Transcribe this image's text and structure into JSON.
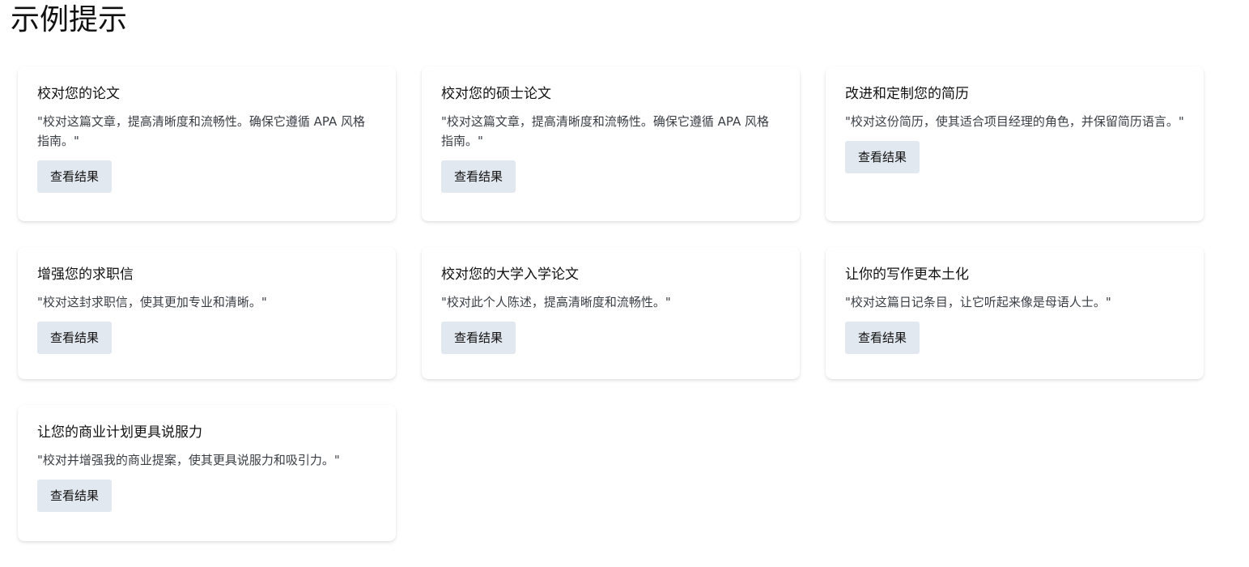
{
  "page": {
    "title": "示例提示"
  },
  "cards": [
    {
      "title": "校对您的论文",
      "prompt": "\"校对这篇文章，提高清晰度和流畅性。确保它遵循 APA 风格指南。\"",
      "button_label": "查看结果"
    },
    {
      "title": "校对您的硕士论文",
      "prompt": "\"校对这篇文章，提高清晰度和流畅性。确保它遵循 APA 风格指南。\"",
      "button_label": "查看结果"
    },
    {
      "title": "改进和定制您的简历",
      "prompt": "\"校对这份简历，使其适合项目经理的角色，并保留简历语言。\"",
      "button_label": "查看结果"
    },
    {
      "title": "增强您的求职信",
      "prompt": "\"校对这封求职信，使其更加专业和清晰。\"",
      "button_label": "查看结果"
    },
    {
      "title": "校对您的大学入学论文",
      "prompt": "\"校对此个人陈述，提高清晰度和流畅性。\"",
      "button_label": "查看结果"
    },
    {
      "title": "让你的写作更本土化",
      "prompt": "\"校对这篇日记条目，让它听起来像是母语人士。\"",
      "button_label": "查看结果"
    },
    {
      "title": "让您的商业计划更具说服力",
      "prompt": "\"校对并增强我的商业提案，使其更具说服力和吸引力。\"",
      "button_label": "查看结果"
    }
  ]
}
